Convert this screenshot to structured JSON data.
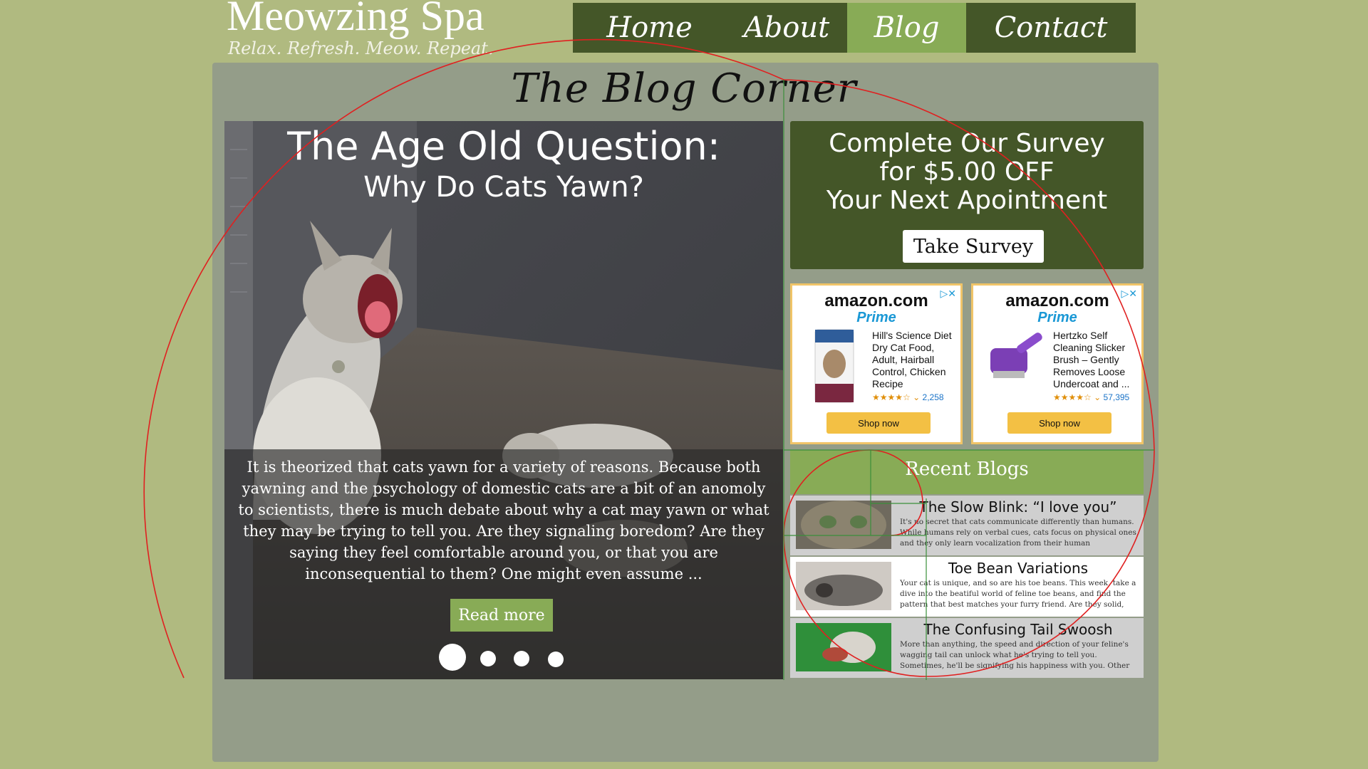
{
  "header": {
    "brand_title": "Meowzing Spa",
    "tagline": "Relax. Refresh. Meow. Repeat."
  },
  "nav": {
    "items": [
      {
        "label": "Home",
        "active": false
      },
      {
        "label": "About",
        "active": false
      },
      {
        "label": "Blog",
        "active": true
      },
      {
        "label": "Contact",
        "active": false
      }
    ]
  },
  "page": {
    "heading": "The Blog Corner"
  },
  "hero": {
    "title": "The Age Old Question:",
    "subtitle": "Why Do Cats Yawn?",
    "excerpt": "It is theorized that cats yawn for a variety of reasons. Because both yawning and the psychology of domestic cats are a bit of an anomoly to scientists, there is much debate about why a cat may yawn or what they may be trying to tell you. Are they signaling boredom? Are they saying they feel comfortable around you, or that you are inconsequential to them? One might even assume ...",
    "read_more_label": "Read more",
    "slides_count": 4,
    "active_slide": 1
  },
  "survey": {
    "line1": "Complete Our Survey",
    "line2": "for $5.00 OFF",
    "line3": "Your Next Apointment",
    "button_label": "Take Survey"
  },
  "ads": [
    {
      "logo": "amazon.com",
      "prime": "Prime",
      "product": "Hill's Science Diet Dry Cat Food, Adult, Hairball Control, Chicken Recipe",
      "rating_count": "2,258",
      "shop_label": "Shop now"
    },
    {
      "logo": "amazon.com",
      "prime": "Prime",
      "product": "Hertzko Self Cleaning Slicker Brush – Gently Removes Loose Undercoat and ...",
      "rating_count": "57,395",
      "shop_label": "Shop now"
    }
  ],
  "recent": {
    "title": "Recent Blogs",
    "items": [
      {
        "title": "The Slow Blink: “I love you”",
        "excerpt": "It's no secret that cats communicate differently than humans. While humans rely on verbal cues, cats focus on physical ones, and they only learn vocalization from their human companions. If ..."
      },
      {
        "title": "Toe Bean Variations",
        "excerpt": "Your cat is unique, and so are his toe beans. This week, take a dive into the beatiful world of feline toe beans, and find the pattern that best matches your furry friend. Are they solid, multi-colored, or ..."
      },
      {
        "title": "The Confusing Tail Swoosh",
        "excerpt": "More than anything, the speed and direction of your feline's wagging tail can unlock what he's trying to tell you. Sometimes, he'll be signifying his happiness with you. Other times he'll be ..."
      }
    ]
  },
  "colors": {
    "page_bg": "#b0ba80",
    "panel_bg": "#949d89",
    "nav_dark": "#445628",
    "accent_green": "#88ab56",
    "overlay_red": "#e02020"
  }
}
